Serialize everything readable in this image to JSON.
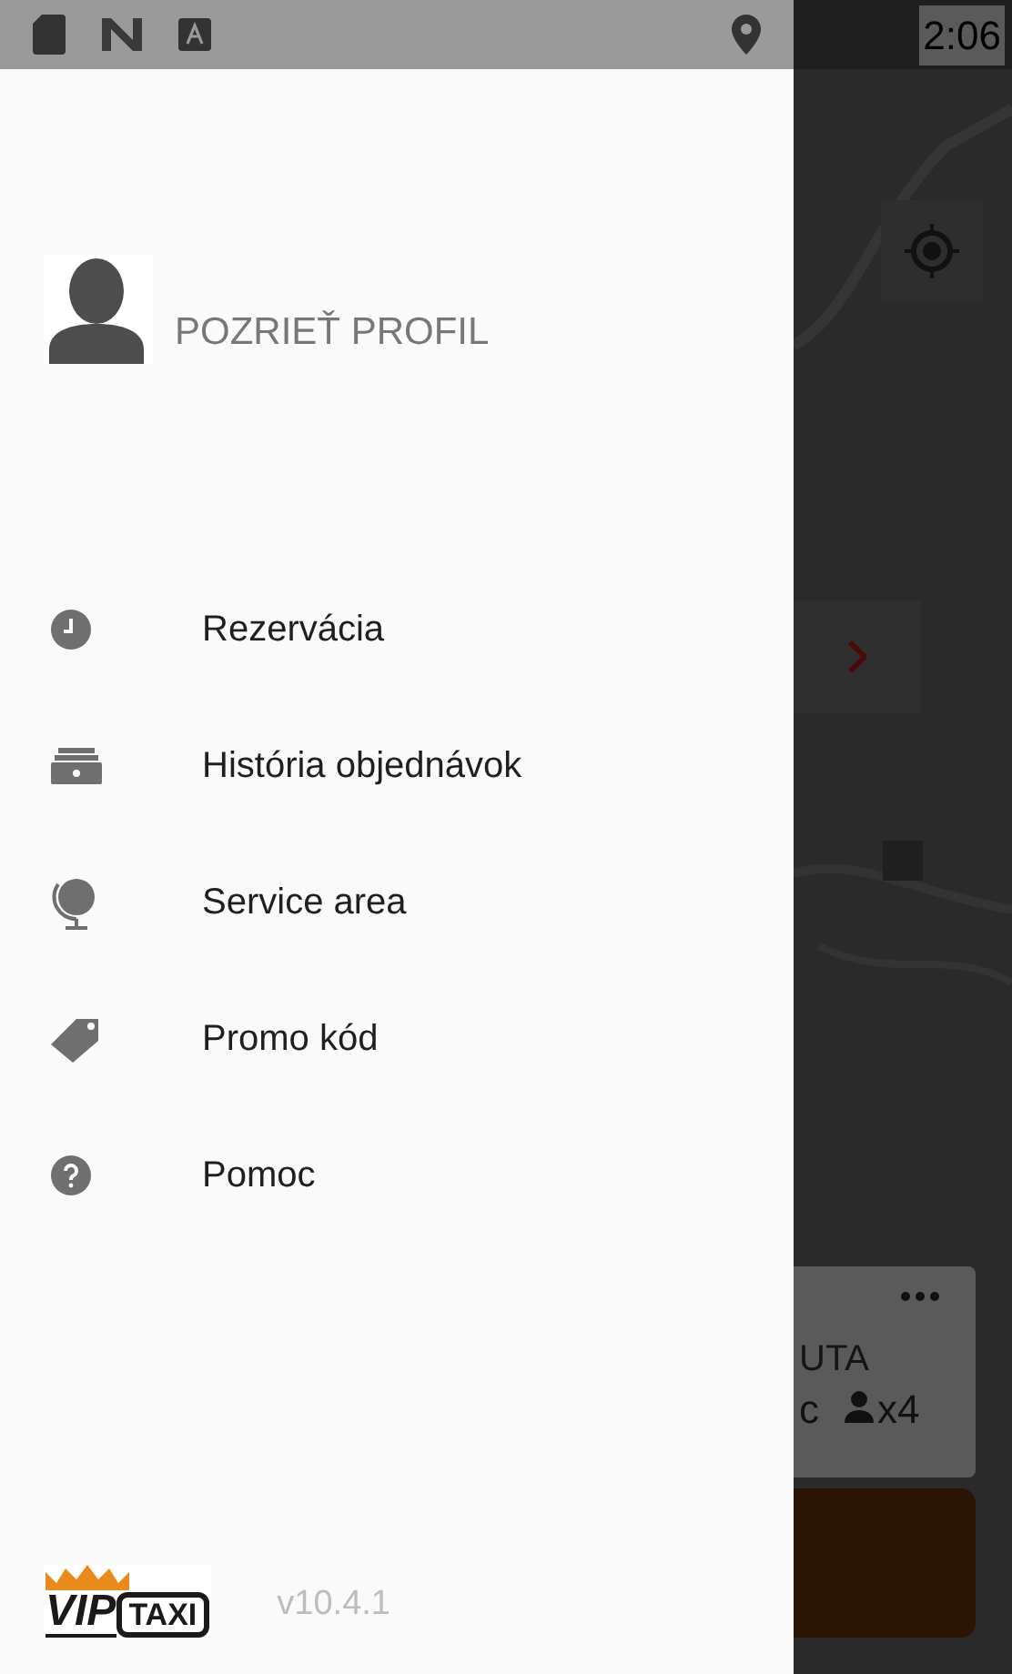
{
  "status_bar": {
    "time": "2:06"
  },
  "drawer": {
    "profile": {
      "label": "POZRIEŤ PROFIL"
    },
    "items": [
      {
        "kind": "clock",
        "label": "Rezervácia"
      },
      {
        "kind": "history",
        "label": "História objednávok"
      },
      {
        "kind": "globe",
        "label": "Service area"
      },
      {
        "kind": "tag",
        "label": "Promo kód"
      },
      {
        "kind": "help",
        "label": "Pomoc"
      }
    ],
    "logo": {
      "word_1": "VIP",
      "word_2": "TAXI"
    },
    "version": "v10.4.1"
  },
  "background": {
    "ride_card": {
      "title": "UTA",
      "detail": "c",
      "seats": "x4"
    }
  }
}
